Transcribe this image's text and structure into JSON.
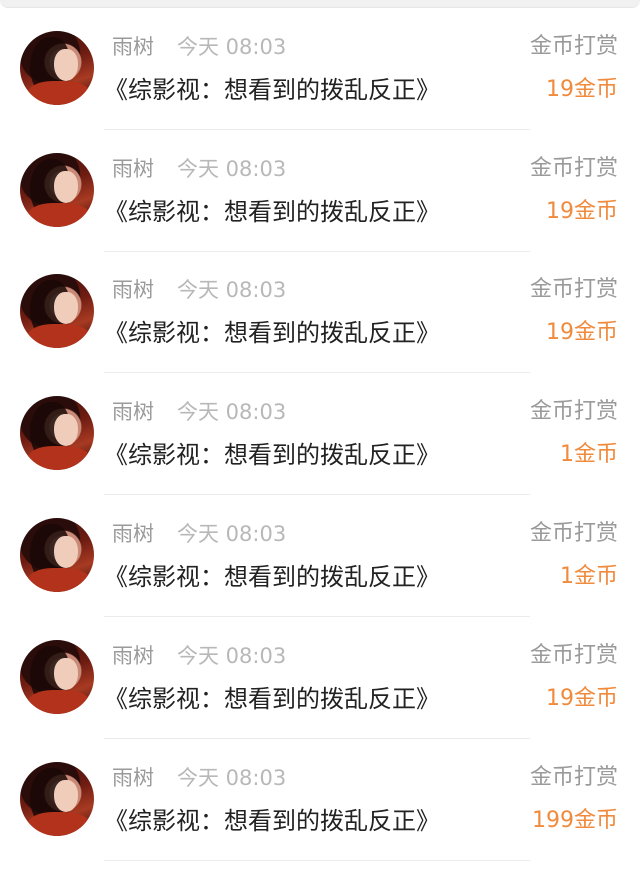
{
  "items": [
    {
      "user": "雨树",
      "time": "今天 08:03",
      "reward_label": "金币打赏",
      "title": "《综影视：想看到的拨乱反正》",
      "amount": "19金币"
    },
    {
      "user": "雨树",
      "time": "今天 08:03",
      "reward_label": "金币打赏",
      "title": "《综影视：想看到的拨乱反正》",
      "amount": "19金币"
    },
    {
      "user": "雨树",
      "time": "今天 08:03",
      "reward_label": "金币打赏",
      "title": "《综影视：想看到的拨乱反正》",
      "amount": "19金币"
    },
    {
      "user": "雨树",
      "time": "今天 08:03",
      "reward_label": "金币打赏",
      "title": "《综影视：想看到的拨乱反正》",
      "amount": "1金币"
    },
    {
      "user": "雨树",
      "time": "今天 08:03",
      "reward_label": "金币打赏",
      "title": "《综影视：想看到的拨乱反正》",
      "amount": "1金币"
    },
    {
      "user": "雨树",
      "time": "今天 08:03",
      "reward_label": "金币打赏",
      "title": "《综影视：想看到的拨乱反正》",
      "amount": "19金币"
    },
    {
      "user": "雨树",
      "time": "今天 08:03",
      "reward_label": "金币打赏",
      "title": "《综影视：想看到的拨乱反正》",
      "amount": "199金币"
    }
  ],
  "colors": {
    "accent_amount": "#f08a3c",
    "muted_text": "#9a9a9a",
    "title_text": "#222222"
  }
}
